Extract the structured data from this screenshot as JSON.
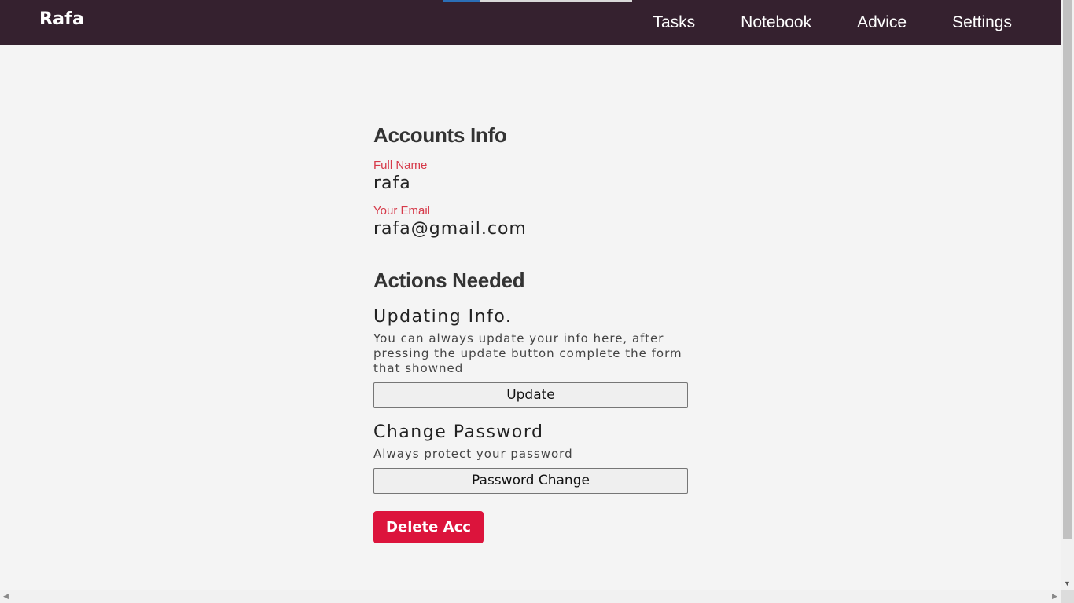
{
  "navbar": {
    "brand": "Rafa",
    "links": [
      "Tasks",
      "Notebook",
      "Advice",
      "Settings"
    ],
    "page_progress": 0.2,
    "colors": {
      "background": "#35212f",
      "progress": "#2b6fb7"
    }
  },
  "account": {
    "title": "Accounts Info",
    "full_name_label": "Full Name",
    "full_name": "rafa",
    "email_label": "Your Email",
    "email": "rafa@gmail.com"
  },
  "actions": {
    "title": "Actions Needed",
    "update": {
      "title": "Updating Info.",
      "desc": "You can always update your info here, after pressing the update button complete the form that showned",
      "button": "Update"
    },
    "password": {
      "title": "Change Password",
      "desc": "Always protect your password",
      "button": "Password Change"
    },
    "delete_button": "Delete Acc"
  },
  "colors": {
    "label": "#d63a4a",
    "danger": "#dc143c"
  }
}
